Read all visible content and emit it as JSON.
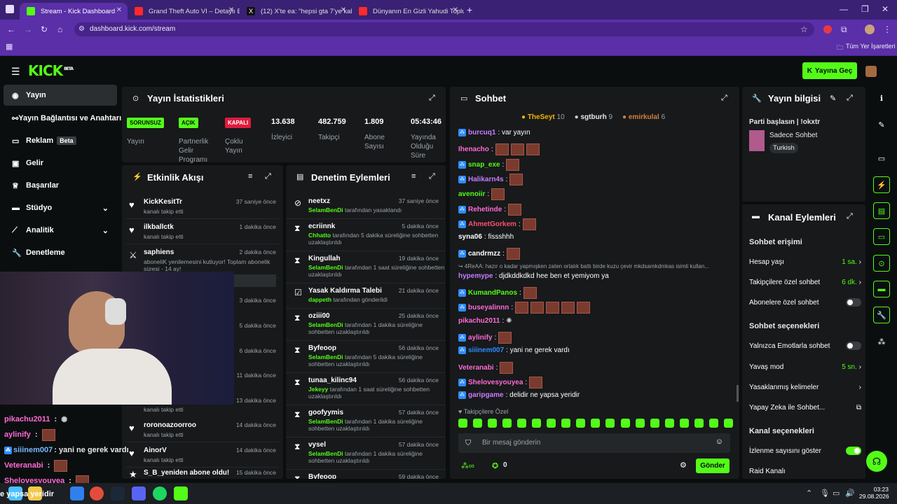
{
  "browser": {
    "tabs": [
      {
        "title": "Stream - Kick Dashboard"
      },
      {
        "title": "Grand Theft Auto VI – Detaylı B"
      },
      {
        "title": "(12) X'te ea: \"hepsi gta 7'ye kal"
      },
      {
        "title": "Dünyanın En Gizli Yahudi Toplul"
      }
    ],
    "url": "dashboard.kick.com/stream",
    "bookmarks_label": "Tüm Yer İşaretleri"
  },
  "header": {
    "logo": "KICK",
    "logo_beta": "BETA",
    "go_live": "Yayına Geç"
  },
  "sidebar": {
    "items": [
      {
        "label": "Yayın"
      },
      {
        "label": "Yayın Bağlantısı ve Anahtarı"
      },
      {
        "label": "Reklam",
        "badge": "Beta"
      },
      {
        "label": "Gelir"
      },
      {
        "label": "Başarılar"
      },
      {
        "label": "Stüdyo"
      },
      {
        "label": "Analitik"
      },
      {
        "label": "Denetleme"
      }
    ]
  },
  "stats": {
    "title": "Yayın İstatistikleri",
    "items": [
      {
        "badge": "SORUNSUZ",
        "label": "Yayın"
      },
      {
        "badge": "AÇIK",
        "label": "Partnerlik Gelir Programı"
      },
      {
        "badge": "KAPALI",
        "label": "Çoklu Yayın"
      },
      {
        "value": "13.638",
        "label": "İzleyici"
      },
      {
        "value": "482.759",
        "label": "Takipçi"
      },
      {
        "value": "1.809",
        "label": "Abone Sayısı"
      },
      {
        "value": "05:43:46",
        "label": "Yayında Olduğu Süre"
      }
    ]
  },
  "activity": {
    "title": "Etkinlik Akışı",
    "rows": [
      {
        "name": "KickKesitTr",
        "time": "37 saniye önce",
        "sub": "kanalı takip etti"
      },
      {
        "name": "ilkballctk",
        "time": "1 dakika önce",
        "sub": "kanalı takip etti"
      },
      {
        "name": "saphiens",
        "time": "2 dakika önce",
        "sub": "aboneliK yenilemesini kutluyor! Toplam abonelik süresi - 14 ay!"
      },
      {
        "time": "3 dakika önce"
      },
      {
        "time": "5 dakika önce"
      },
      {
        "time": "6 dakika önce"
      },
      {
        "time": "11 dakika önce"
      },
      {
        "time": "13 dakika önce",
        "sub": "kanalı takip etti"
      },
      {
        "name": "roronoazoorroo",
        "time": "14 dakika önce",
        "sub": "kanalı takip etti"
      },
      {
        "name": "AinorV",
        "time": "14 dakika önce",
        "sub": "kanalı takip etti"
      },
      {
        "name": "S_B_yeniden abone oldu!",
        "time": "15 dakika önce"
      }
    ]
  },
  "moderation": {
    "title": "Denetim Eylemleri",
    "rows": [
      {
        "name": "neetxz",
        "time": "37 saniye önce",
        "mod": "SelamBenDi",
        "sub": " tarafından yasaklandı"
      },
      {
        "name": "ecriinnk",
        "time": "5 dakika önce",
        "mod": "Chhatto",
        "sub": " tarafından 5 dakika süreliğine sohbetten uzaklaştırıldı"
      },
      {
        "name": "Kingullah",
        "time": "19 dakika önce",
        "mod": "SelamBenDi",
        "sub": " tarafından 1 saat süreliğine sohbetten uzaklaştırıldı"
      },
      {
        "name": "Yasak Kaldırma Talebi",
        "time": "21 dakika önce",
        "mod": "dappeth",
        "sub": " tarafından gönderildi"
      },
      {
        "name": "oziii00",
        "time": "25 dakika önce",
        "mod": "SelamBenDi",
        "sub": " tarafından 1 dakika süreliğine sohbetten uzaklaştırıldı"
      },
      {
        "name": "Byfeoop",
        "time": "56 dakika önce",
        "mod": "SelamBenDi",
        "sub": " tarafından 5 dakika süreliğine sohbetten uzaklaştırıldı"
      },
      {
        "name": "tunaa_kilinc94",
        "time": "56 dakika önce",
        "mod": "Jekeyy",
        "sub": " tarafından 1 saat süreliğine sohbetten uzaklaştırıldı"
      },
      {
        "name": "goofyymis",
        "time": "57 dakika önce",
        "mod": "SelamBenDi",
        "sub": " tarafından 1 dakika süreliğine sohbetten uzaklaştırıldı"
      },
      {
        "name": "vysel",
        "time": "57 dakika önce",
        "mod": "SelamBenDi",
        "sub": " tarafından 1 dakika süreliğine sohbetten uzaklaştırıldı"
      },
      {
        "name": "Byfeoop",
        "time": "59 dakika önce"
      }
    ]
  },
  "chat": {
    "title": "Sohbet",
    "top": [
      {
        "name": "TheSeyt",
        "n": "10"
      },
      {
        "name": "sgtburh",
        "n": "9"
      },
      {
        "name": "emirkulal",
        "n": "6"
      }
    ],
    "lines": [
      {
        "user": "burcuq1",
        "color": "#c77dff",
        "text": ": var yayın"
      },
      {
        "user": "Ihenacho",
        "color": "#ff6ad5",
        "text": ":",
        "emotes": 3
      },
      {
        "user": "snap_exe",
        "color": "#53fc18",
        "text": ":",
        "emotes": 1
      },
      {
        "user": "Halikarn4s",
        "color": "#c77dff",
        "text": ":",
        "emotes": 1
      },
      {
        "user": "avenoiir",
        "color": "#53fc18",
        "text": ":",
        "emotes": 1
      },
      {
        "user": "Rehetinde",
        "color": "#ff6ad5",
        "text": ":",
        "emotes": 1
      },
      {
        "user": "AhmetGorkem",
        "color": "#ff4d6d",
        "text": ":",
        "emotes": 1
      },
      {
        "user": "syna06",
        "color": "#fff",
        "text": ": fissshhh"
      },
      {
        "user": "candrmzz",
        "color": "#fff",
        "text": ":",
        "emotes": 1
      },
      {
        "user": "",
        "color": "#9ca3a8",
        "text": "↪ 4ReAA: hazır o kadar yapmışken zaten ortalık battı birde kuzu çevir mkdsamkdmkas isimli kullan..."
      },
      {
        "user": "hypemype",
        "color": "#c77dff",
        "text": ": djdkddkdkd hee ben et yemiyom ya"
      },
      {
        "user": "KumandPanos",
        "color": "#53fc18",
        "text": ":",
        "emotes": 1
      },
      {
        "user": "buseyalinnn",
        "color": "#ff6ad5",
        "text": ":",
        "emotes": 5
      },
      {
        "user": "pikachu2011",
        "color": "#ff6ad5",
        "text": ":",
        "emotes": 0
      },
      {
        "user": "aylinify",
        "color": "#ff6ad5",
        "text": ":",
        "emotes": 1
      },
      {
        "user": "siiinem007",
        "color": "#2d8cff",
        "text": ": yani ne gerek vardı"
      },
      {
        "user": "Veteranabi",
        "color": "#ff6ad5",
        "text": ":",
        "emotes": 1
      },
      {
        "user": "Shelovesyouyea",
        "color": "#ff6ad5",
        "text": ":",
        "emotes": 1
      },
      {
        "user": "garipgame",
        "color": "#c77dff",
        "text": ": delidir ne yapsa yeridir"
      }
    ],
    "followers_only": "Takipçilere Özel",
    "placeholder": "Bir mesaj gönderin",
    "count": "0",
    "send": "Gönder"
  },
  "stream_info": {
    "title": "Yayın bilgisi",
    "stream_title": "Parti başlasın | !okxtr",
    "category": "Sadece Sohbet",
    "language": "Turkish"
  },
  "channel": {
    "title": "Kanal Eylemleri",
    "chat_access": "Sohbet erişimi",
    "rows1": [
      {
        "label": "Hesap yaşı",
        "value": "1 sa."
      },
      {
        "label": "Takipçilere özel sohbet",
        "value": "6 dk."
      },
      {
        "label": "Abonelere özel sohbet",
        "toggle": false
      }
    ],
    "chat_options": "Sohbet seçenekleri",
    "rows2": [
      {
        "label": "Yalnızca Emotlarla sohbet",
        "toggle": false
      },
      {
        "label": "Yavaş mod",
        "value": "5 sn."
      },
      {
        "label": "Yasaklanmış kelimeler"
      },
      {
        "label": "Yapay Zeka ile Sohbet..."
      }
    ],
    "channel_options": "Kanal seçenekleri",
    "rows3": [
      {
        "label": "İzlenme sayısını göster",
        "toggle": true
      },
      {
        "label": "Raid Kanalı"
      }
    ]
  },
  "overlay_chat": [
    {
      "user": "pikachu2011",
      "color": "#ff6ad5"
    },
    {
      "user": "aylinify",
      "color": "#ff6ad5"
    },
    {
      "user": "siiinem007",
      "color": "#7ab8ff",
      "text": ": yani ne gerek vardı"
    },
    {
      "user": "Veteranabi",
      "color": "#ff6ad5"
    },
    {
      "user": "Shelovesyouyea",
      "color": "#ff6ad5"
    }
  ],
  "overlay_bottom": "e yapsa yeridir",
  "taskbar": {
    "time": "03:23",
    "date": "29.08.2026"
  },
  "colors": {
    "accent": "#53fc18",
    "panel": "#17191b",
    "bg": "#0b0e0f",
    "chrome": "#5a2fa8"
  }
}
